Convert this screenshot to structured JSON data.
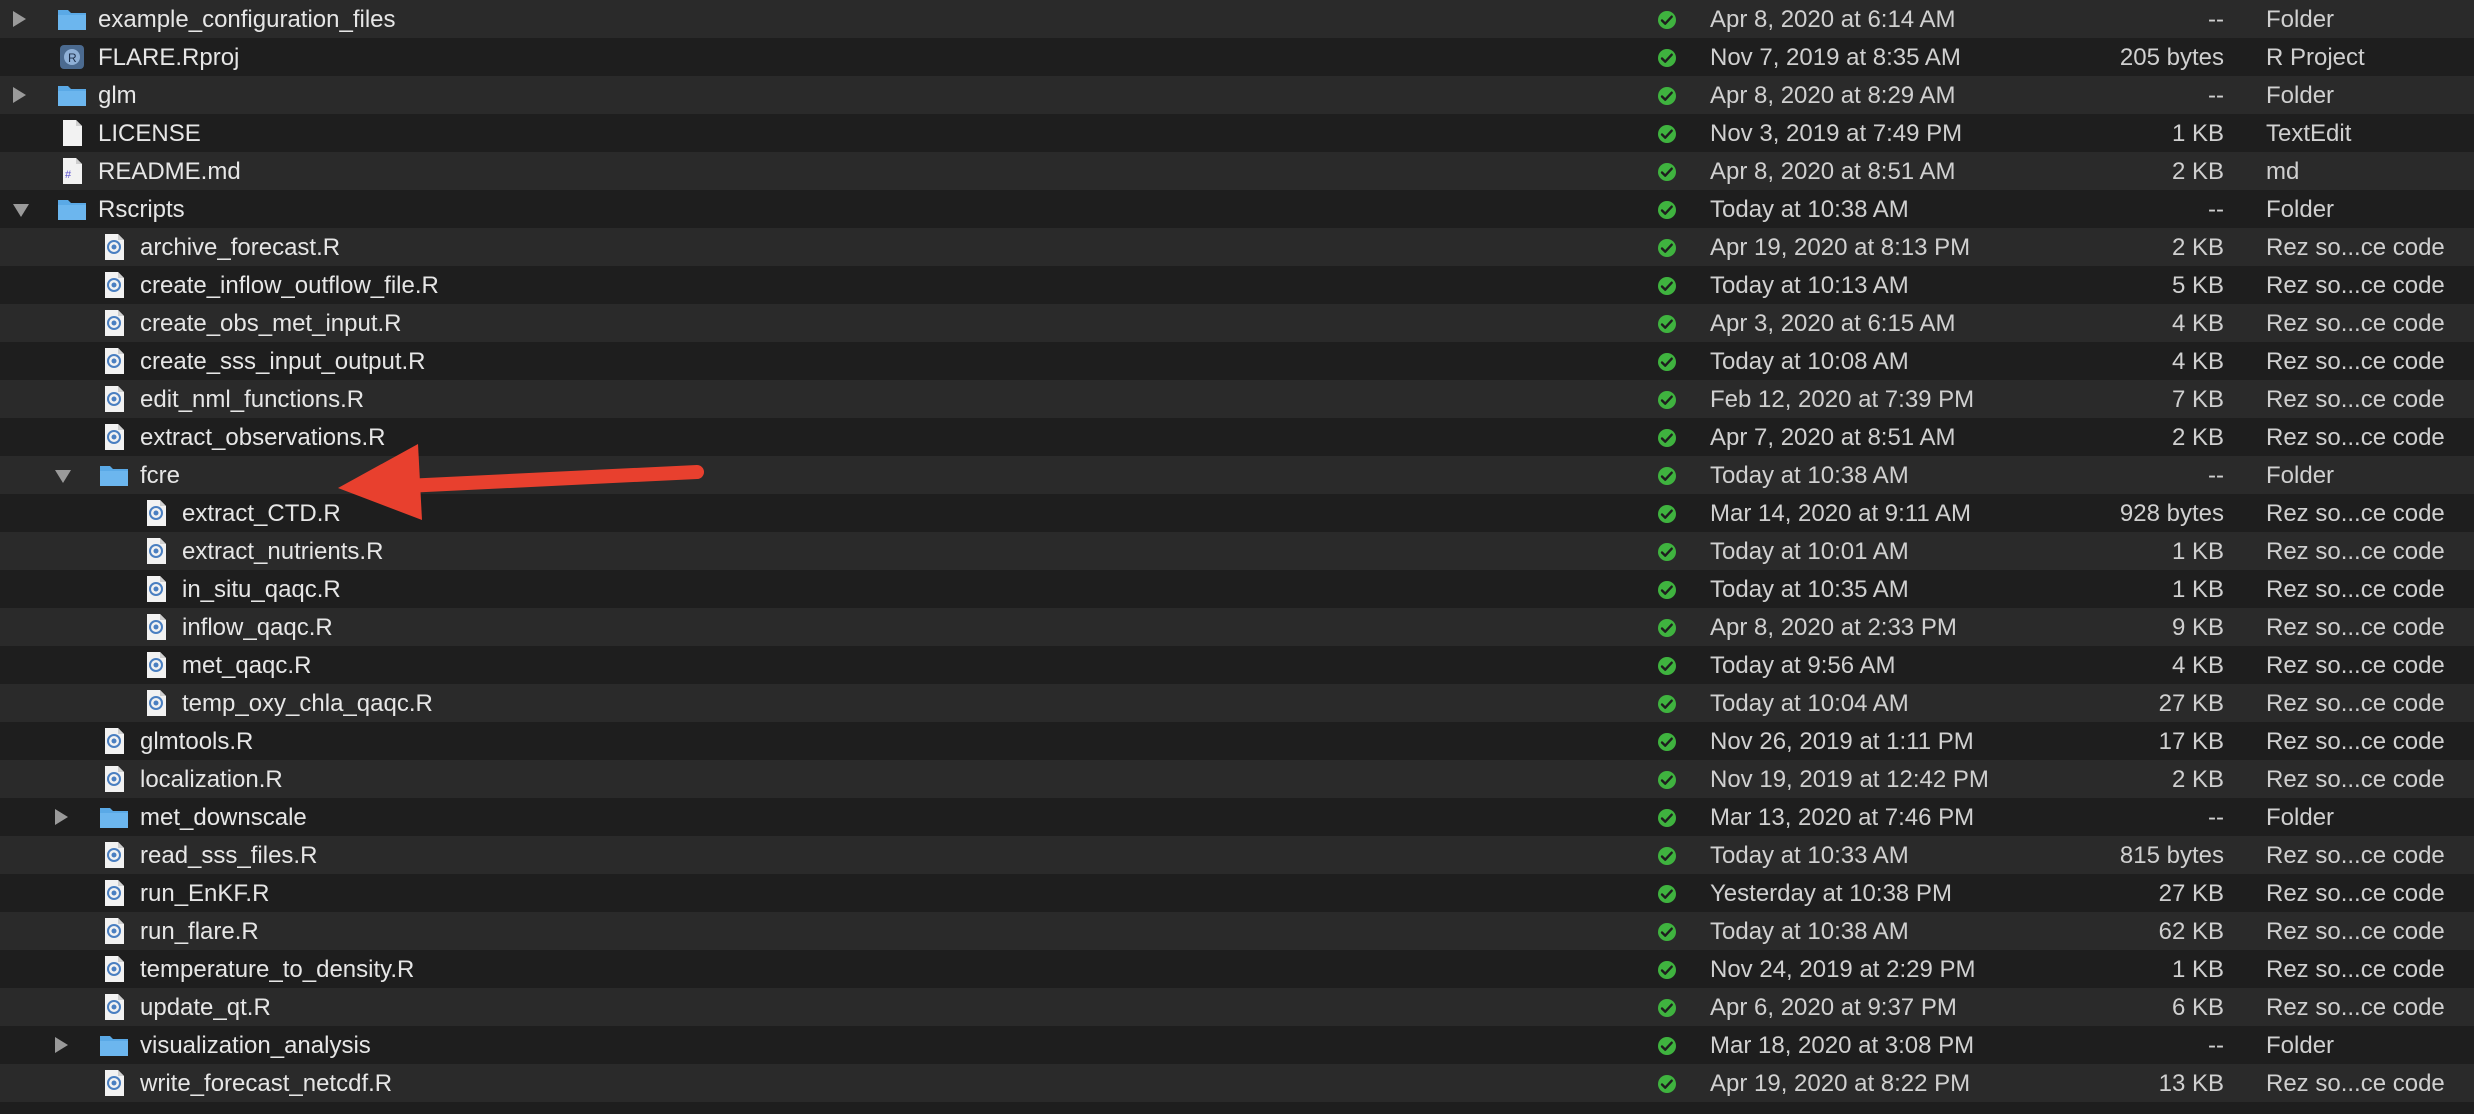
{
  "colors": {
    "row_odd": "#2a2a2a",
    "row_even": "#1e1e1e",
    "folder_blue": "#5aa9e6",
    "status_green": "#3fb33f",
    "arrow_red": "#e8402e"
  },
  "files": [
    {
      "name": "example_configuration_files",
      "date": "Apr 8, 2020 at 6:14 AM",
      "size": "--",
      "kind": "Folder",
      "icon": "folder-icon",
      "level": 0,
      "disclosure": "collapsed"
    },
    {
      "name": "FLARE.Rproj",
      "date": "Nov 7, 2019 at 8:35 AM",
      "size": "205 bytes",
      "kind": "R Project",
      "icon": "rproject-icon",
      "level": 0,
      "disclosure": "none"
    },
    {
      "name": "glm",
      "date": "Apr 8, 2020 at 8:29 AM",
      "size": "--",
      "kind": "Folder",
      "icon": "folder-icon",
      "level": 0,
      "disclosure": "collapsed"
    },
    {
      "name": "LICENSE",
      "date": "Nov 3, 2019 at 7:49 PM",
      "size": "1 KB",
      "kind": "TextEdit",
      "icon": "text-document-icon",
      "level": 0,
      "disclosure": "none"
    },
    {
      "name": "README.md",
      "date": "Apr 8, 2020 at 8:51 AM",
      "size": "2 KB",
      "kind": "md",
      "icon": "markdown-document-icon",
      "level": 0,
      "disclosure": "none"
    },
    {
      "name": "Rscripts",
      "date": "Today at 10:38 AM",
      "size": "--",
      "kind": "Folder",
      "icon": "folder-icon",
      "level": 0,
      "disclosure": "expanded"
    },
    {
      "name": "archive_forecast.R",
      "date": "Apr 19, 2020 at 8:13 PM",
      "size": "2 KB",
      "kind": "Rez so...ce code",
      "icon": "r-source-file-icon",
      "level": 1,
      "disclosure": "none"
    },
    {
      "name": "create_inflow_outflow_file.R",
      "date": "Today at 10:13 AM",
      "size": "5 KB",
      "kind": "Rez so...ce code",
      "icon": "r-source-file-icon",
      "level": 1,
      "disclosure": "none"
    },
    {
      "name": "create_obs_met_input.R",
      "date": "Apr 3, 2020 at 6:15 AM",
      "size": "4 KB",
      "kind": "Rez so...ce code",
      "icon": "r-source-file-icon",
      "level": 1,
      "disclosure": "none"
    },
    {
      "name": "create_sss_input_output.R",
      "date": "Today at 10:08 AM",
      "size": "4 KB",
      "kind": "Rez so...ce code",
      "icon": "r-source-file-icon",
      "level": 1,
      "disclosure": "none"
    },
    {
      "name": "edit_nml_functions.R",
      "date": "Feb 12, 2020 at 7:39 PM",
      "size": "7 KB",
      "kind": "Rez so...ce code",
      "icon": "r-source-file-icon",
      "level": 1,
      "disclosure": "none"
    },
    {
      "name": "extract_observations.R",
      "date": "Apr 7, 2020 at 8:51 AM",
      "size": "2 KB",
      "kind": "Rez so...ce code",
      "icon": "r-source-file-icon",
      "level": 1,
      "disclosure": "none"
    },
    {
      "name": "fcre",
      "date": "Today at 10:38 AM",
      "size": "--",
      "kind": "Folder",
      "icon": "folder-icon",
      "level": 1,
      "disclosure": "expanded"
    },
    {
      "name": "extract_CTD.R",
      "date": "Mar 14, 2020 at 9:11 AM",
      "size": "928 bytes",
      "kind": "Rez so...ce code",
      "icon": "r-source-file-icon",
      "level": 2,
      "disclosure": "none"
    },
    {
      "name": "extract_nutrients.R",
      "date": "Today at 10:01 AM",
      "size": "1 KB",
      "kind": "Rez so...ce code",
      "icon": "r-source-file-icon",
      "level": 2,
      "disclosure": "none"
    },
    {
      "name": "in_situ_qaqc.R",
      "date": "Today at 10:35 AM",
      "size": "1 KB",
      "kind": "Rez so...ce code",
      "icon": "r-source-file-icon",
      "level": 2,
      "disclosure": "none"
    },
    {
      "name": "inflow_qaqc.R",
      "date": "Apr 8, 2020 at 2:33 PM",
      "size": "9 KB",
      "kind": "Rez so...ce code",
      "icon": "r-source-file-icon",
      "level": 2,
      "disclosure": "none"
    },
    {
      "name": "met_qaqc.R",
      "date": "Today at 9:56 AM",
      "size": "4 KB",
      "kind": "Rez so...ce code",
      "icon": "r-source-file-icon",
      "level": 2,
      "disclosure": "none"
    },
    {
      "name": "temp_oxy_chla_qaqc.R",
      "date": "Today at 10:04 AM",
      "size": "27 KB",
      "kind": "Rez so...ce code",
      "icon": "r-source-file-icon",
      "level": 2,
      "disclosure": "none"
    },
    {
      "name": "glmtools.R",
      "date": "Nov 26, 2019 at 1:11 PM",
      "size": "17 KB",
      "kind": "Rez so...ce code",
      "icon": "r-source-file-icon",
      "level": 1,
      "disclosure": "none"
    },
    {
      "name": "localization.R",
      "date": "Nov 19, 2019 at 12:42 PM",
      "size": "2 KB",
      "kind": "Rez so...ce code",
      "icon": "r-source-file-icon",
      "level": 1,
      "disclosure": "none"
    },
    {
      "name": "met_downscale",
      "date": "Mar 13, 2020 at 7:46 PM",
      "size": "--",
      "kind": "Folder",
      "icon": "folder-icon",
      "level": 1,
      "disclosure": "collapsed"
    },
    {
      "name": "read_sss_files.R",
      "date": "Today at 10:33 AM",
      "size": "815 bytes",
      "kind": "Rez so...ce code",
      "icon": "r-source-file-icon",
      "level": 1,
      "disclosure": "none"
    },
    {
      "name": "run_EnKF.R",
      "date": "Yesterday at 10:38 PM",
      "size": "27 KB",
      "kind": "Rez so...ce code",
      "icon": "r-source-file-icon",
      "level": 1,
      "disclosure": "none"
    },
    {
      "name": "run_flare.R",
      "date": "Today at 10:38 AM",
      "size": "62 KB",
      "kind": "Rez so...ce code",
      "icon": "r-source-file-icon",
      "level": 1,
      "disclosure": "none"
    },
    {
      "name": "temperature_to_density.R",
      "date": "Nov 24, 2019 at 2:29 PM",
      "size": "1 KB",
      "kind": "Rez so...ce code",
      "icon": "r-source-file-icon",
      "level": 1,
      "disclosure": "none"
    },
    {
      "name": "update_qt.R",
      "date": "Apr 6, 2020 at 9:37 PM",
      "size": "6 KB",
      "kind": "Rez so...ce code",
      "icon": "r-source-file-icon",
      "level": 1,
      "disclosure": "none"
    },
    {
      "name": "visualization_analysis",
      "date": "Mar 18, 2020 at 3:08 PM",
      "size": "--",
      "kind": "Folder",
      "icon": "folder-icon",
      "level": 1,
      "disclosure": "collapsed"
    },
    {
      "name": "write_forecast_netcdf.R",
      "date": "Apr 19, 2020 at 8:22 PM",
      "size": "13 KB",
      "kind": "Rez so...ce code",
      "icon": "r-source-file-icon",
      "level": 1,
      "disclosure": "none"
    }
  ]
}
